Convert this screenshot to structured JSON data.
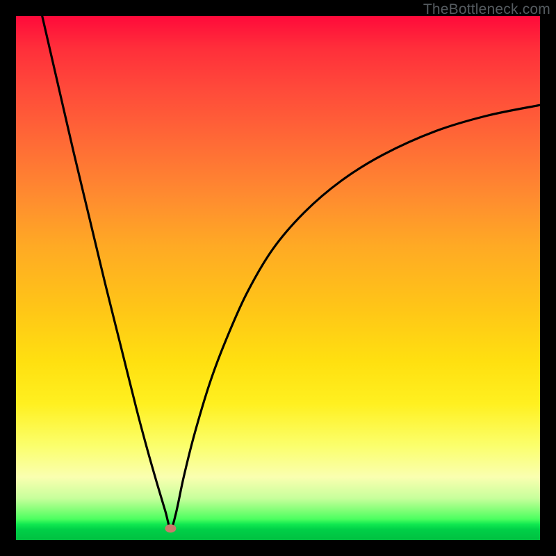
{
  "watermark": "TheBottleneck.com",
  "colors": {
    "background": "#000000",
    "curve_stroke": "#000000",
    "dot_fill": "#c97a6b",
    "gradient_top": "#ff0a3a",
    "gradient_bottom": "#00c040"
  },
  "chart_data": {
    "type": "line",
    "title": "",
    "xlabel": "",
    "ylabel": "",
    "xlim": [
      0,
      100
    ],
    "ylim": [
      0,
      100
    ],
    "legend": false,
    "grid": false,
    "vertex": {
      "x": 29.5,
      "y": 2.2
    },
    "series": [
      {
        "name": "bottleneck-curve",
        "x": [
          5.0,
          8.0,
          11.0,
          14.0,
          17.0,
          20.0,
          23.0,
          25.0,
          27.0,
          28.5,
          29.5,
          30.5,
          32.0,
          34.0,
          37.0,
          40.0,
          44.0,
          49.0,
          55.0,
          62.0,
          70.0,
          80.0,
          90.0,
          100.0
        ],
        "y": [
          100.0,
          87.0,
          74.0,
          61.5,
          49.0,
          37.0,
          25.0,
          17.5,
          10.5,
          5.5,
          2.2,
          5.0,
          12.0,
          20.0,
          30.0,
          38.0,
          47.0,
          55.5,
          62.5,
          68.5,
          73.5,
          78.0,
          81.0,
          83.0
        ]
      }
    ],
    "markers": [
      {
        "name": "optimal-dot",
        "x": 29.5,
        "y": 2.2
      }
    ]
  }
}
